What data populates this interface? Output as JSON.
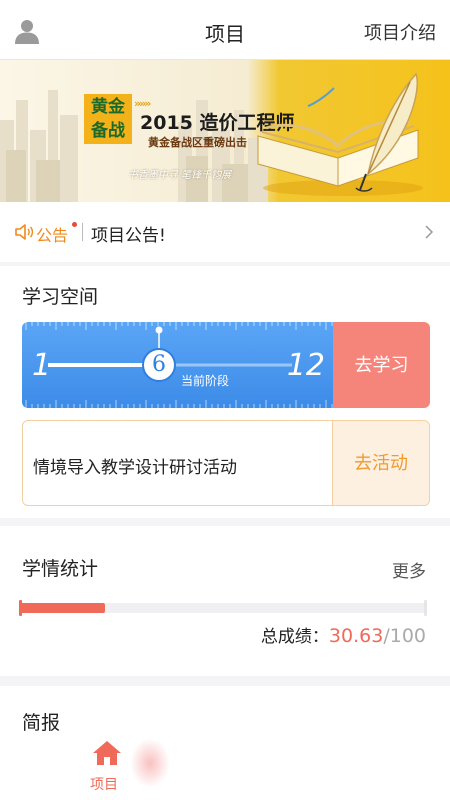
{
  "header": {
    "title": "项目",
    "intro_link": "项目介绍"
  },
  "banner": {
    "badge_line1": "黄金",
    "badge_line2": "备战",
    "arrows": "»»»",
    "headline": "2015 造价工程师",
    "subline": "黄金备战区重磅出击",
    "calligraphy": "书香墨中寻  笔锋千钧展"
  },
  "notice": {
    "label": "公告",
    "text": "项目公告!"
  },
  "study_space": {
    "title": "学习空间",
    "progress": {
      "start": "1",
      "current": "6",
      "end": "12",
      "current_label": "当前阶段",
      "current_fraction": 0.455
    },
    "go_study_label": "去学习",
    "activity": {
      "title": "情境导入教学设计研讨活动",
      "button_label": "去活动"
    }
  },
  "stats": {
    "title": "学情统计",
    "more_label": "更多",
    "score_label": "总成绩：",
    "score_value": "30.63",
    "score_total": "/100",
    "score_fraction": 0.21
  },
  "brief": {
    "title": "简报"
  },
  "tabbar": {
    "home_label": "项目"
  },
  "colors": {
    "accent": "#f06a5a",
    "ruler_blue": "#4796ee",
    "activity_orange": "#f19a2e",
    "notice_orange": "#f08a1c"
  },
  "icons": {
    "user": "user-icon",
    "speaker": "speaker-icon",
    "chevron": "chevron-right-icon",
    "home": "home-icon"
  }
}
